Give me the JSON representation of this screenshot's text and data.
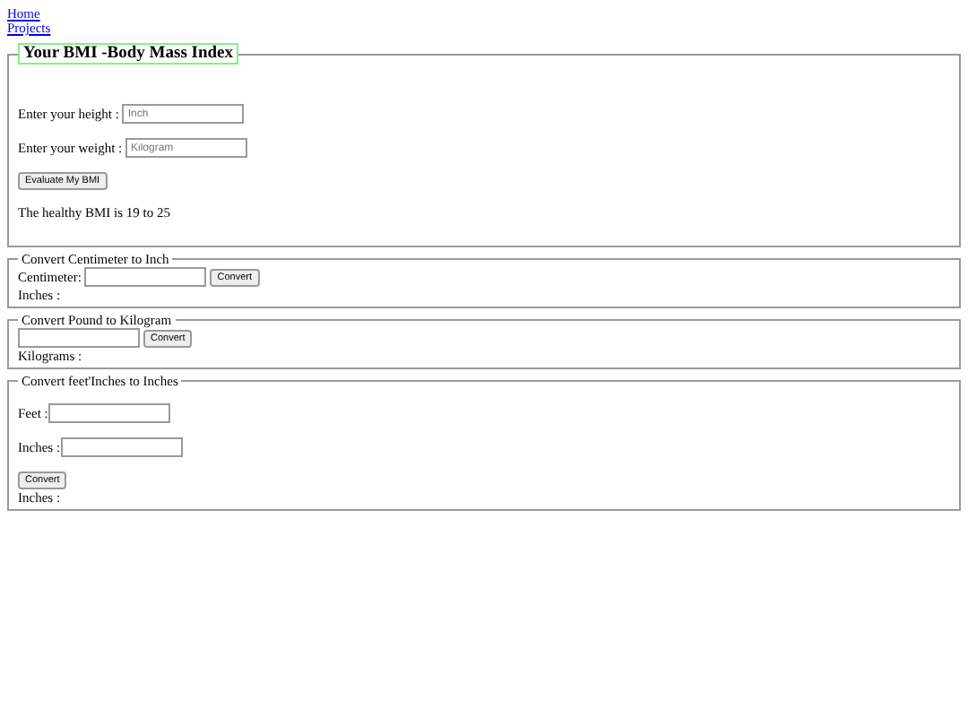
{
  "links": [
    {
      "label": "Home"
    },
    {
      "label": "Projects"
    }
  ],
  "bmi": {
    "title": "Your BMI -Body Mass Index",
    "fields": [
      {
        "label": "Enter your height :",
        "placeholder": "Inch"
      },
      {
        "label": "Enter your weight :",
        "placeholder": "Kilogram"
      }
    ],
    "button": "Evaluate My BMI",
    "note": "The healthy BMI is 19 to 25"
  },
  "converters": [
    {
      "title": "Convert Centimeter to Inch",
      "kind": "inline",
      "fields": [
        {
          "label": "Centimeter:"
        }
      ],
      "button": "Convert",
      "result": "Inches :"
    },
    {
      "title": "Convert Pound to Kilogram",
      "kind": "inline",
      "fields": [
        {
          "kind": "bare"
        }
      ],
      "button": "Convert",
      "result": "Kilograms :"
    },
    {
      "title": "Convert feet'Inches to Inches",
      "kind": "stacked",
      "fields": [
        {
          "label": "Feet :"
        },
        {
          "label": "Inches :"
        }
      ],
      "button": "Convert",
      "result": "Inches :"
    }
  ]
}
